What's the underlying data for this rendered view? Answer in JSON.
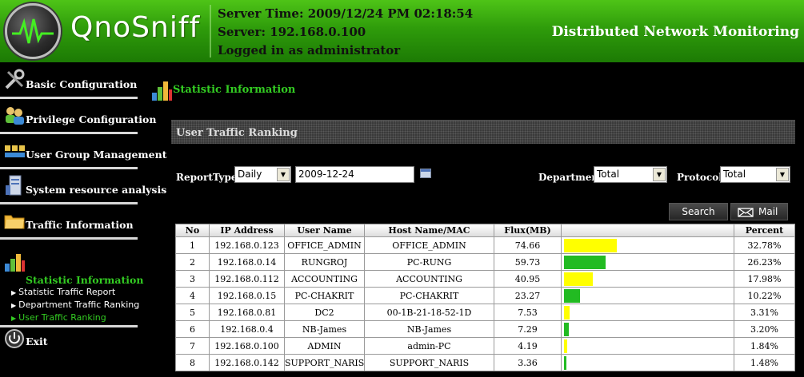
{
  "header": {
    "brand": "QnoSniff",
    "server_time": "Server Time: 2009/12/24 PM 02:18:54",
    "server": "Server: 192.168.0.100",
    "login": "Logged in as administrator",
    "title": "Distributed Network Monitoring"
  },
  "sidebar": {
    "items": [
      {
        "label": "Basic Configuration",
        "icon": "tools-icon"
      },
      {
        "label": "Privilege Configuration",
        "icon": "users-icon"
      },
      {
        "label": "User Group Management",
        "icon": "user-group-icon"
      },
      {
        "label": "System resource analysis",
        "icon": "server-icon"
      },
      {
        "label": "Traffic Information",
        "icon": "folder-icon"
      },
      {
        "label": "Statistic Information",
        "icon": "bar-chart-icon"
      },
      {
        "label": "Exit",
        "icon": "power-icon"
      }
    ],
    "sub_items": [
      "Statistic Traffic Report",
      "Department Traffic Ranking",
      "User Traffic Ranking"
    ],
    "active_sub": "User Traffic Ranking"
  },
  "main": {
    "section_title": "Statistic Information",
    "panel_title": "User Traffic Ranking",
    "filters": {
      "report_type_label": "ReportType",
      "report_type_value": "Daily",
      "date_value": "2009-12-24",
      "department_label": "Department",
      "department_value": "Total",
      "protocol_label": "Protocol",
      "protocol_value": "Total"
    },
    "buttons": {
      "search": "Search",
      "mail": "Mail"
    },
    "table": {
      "headers": [
        "No",
        "IP Address",
        "User Name",
        "Host Name/MAC",
        "Flux(MB)",
        "",
        "Percent"
      ],
      "rows": [
        {
          "no": "1",
          "ip": "192.168.0.123",
          "user": "OFFICE_ADMIN",
          "host": "OFFICE_ADMIN",
          "flux": "74.66",
          "percent": "32.78%",
          "pct": 32.78,
          "color": "#ffff00"
        },
        {
          "no": "2",
          "ip": "192.168.0.14",
          "user": "RUNGROJ",
          "host": "PC-RUNG",
          "flux": "59.73",
          "percent": "26.23%",
          "pct": 26.23,
          "color": "#22bb22"
        },
        {
          "no": "3",
          "ip": "192.168.0.112",
          "user": "ACCOUNTING",
          "host": "ACCOUNTING",
          "flux": "40.95",
          "percent": "17.98%",
          "pct": 17.98,
          "color": "#ffff00"
        },
        {
          "no": "4",
          "ip": "192.168.0.15",
          "user": "PC-CHAKRIT",
          "host": "PC-CHAKRIT",
          "flux": "23.27",
          "percent": "10.22%",
          "pct": 10.22,
          "color": "#22bb22"
        },
        {
          "no": "5",
          "ip": "192.168.0.81",
          "user": "DC2",
          "host": "00-1B-21-18-52-1D",
          "flux": "7.53",
          "percent": "3.31%",
          "pct": 3.31,
          "color": "#ffff00"
        },
        {
          "no": "6",
          "ip": "192.168.0.4",
          "user": "NB-James",
          "host": "NB-James",
          "flux": "7.29",
          "percent": "3.20%",
          "pct": 3.2,
          "color": "#22bb22"
        },
        {
          "no": "7",
          "ip": "192.168.0.100",
          "user": "ADMIN",
          "host": "admin-PC",
          "flux": "4.19",
          "percent": "1.84%",
          "pct": 1.84,
          "color": "#ffff00"
        },
        {
          "no": "8",
          "ip": "192.168.0.142",
          "user": "SUPPORT_NARIS",
          "host": "SUPPORT_NARIS",
          "flux": "3.36",
          "percent": "1.48%",
          "pct": 1.48,
          "color": "#22bb22"
        }
      ]
    }
  }
}
